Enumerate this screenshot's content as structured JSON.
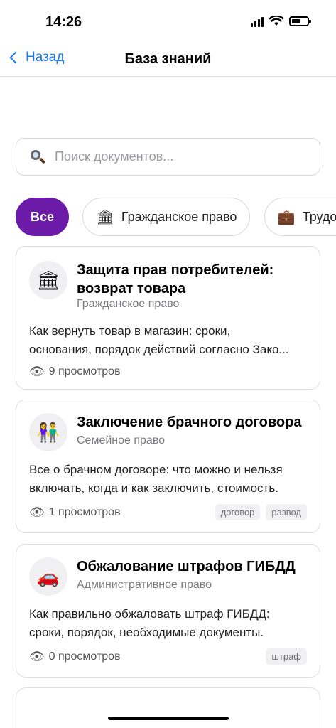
{
  "status": {
    "time": "14:26"
  },
  "nav": {
    "back_label": "Назад",
    "title": "База знаний"
  },
  "search": {
    "placeholder": "Поиск документов..."
  },
  "chips": [
    {
      "label": "Все",
      "icon": "",
      "active": true
    },
    {
      "label": "Гражданское право",
      "icon": "🏛"
    },
    {
      "label": "Трудово",
      "icon": "💼"
    }
  ],
  "cards": [
    {
      "icon": "🏛",
      "title_line1": "Защита прав потребителей:",
      "title_line2": "возврат товара",
      "category": "Гражданское право",
      "desc_line1": "Как вернуть товар в магазин: сроки,",
      "desc_line2": "основания, порядок действий согласно Зако...",
      "views": "9 просмотров",
      "tags": []
    },
    {
      "icon": "👫",
      "title_line1": "Заключение брачного договора",
      "category": "Семейное право",
      "desc_line1": "Все о брачном договоре: что можно и нельзя",
      "desc_line2": "включать, когда и как заключить, стоимость.",
      "views": "1 просмотров",
      "tags": [
        "договор",
        "развод"
      ]
    },
    {
      "icon": "🚗",
      "title_line1": "Обжалование штрафов ГИБДД",
      "category": "Административное право",
      "desc_line1": "Как правильно обжаловать штраф ГИБДД:",
      "desc_line2": "сроки, порядок, необходимые документы.",
      "views": "0 просмотров",
      "tags": [
        "штраф"
      ]
    }
  ],
  "icons": {
    "eye": "👁"
  }
}
